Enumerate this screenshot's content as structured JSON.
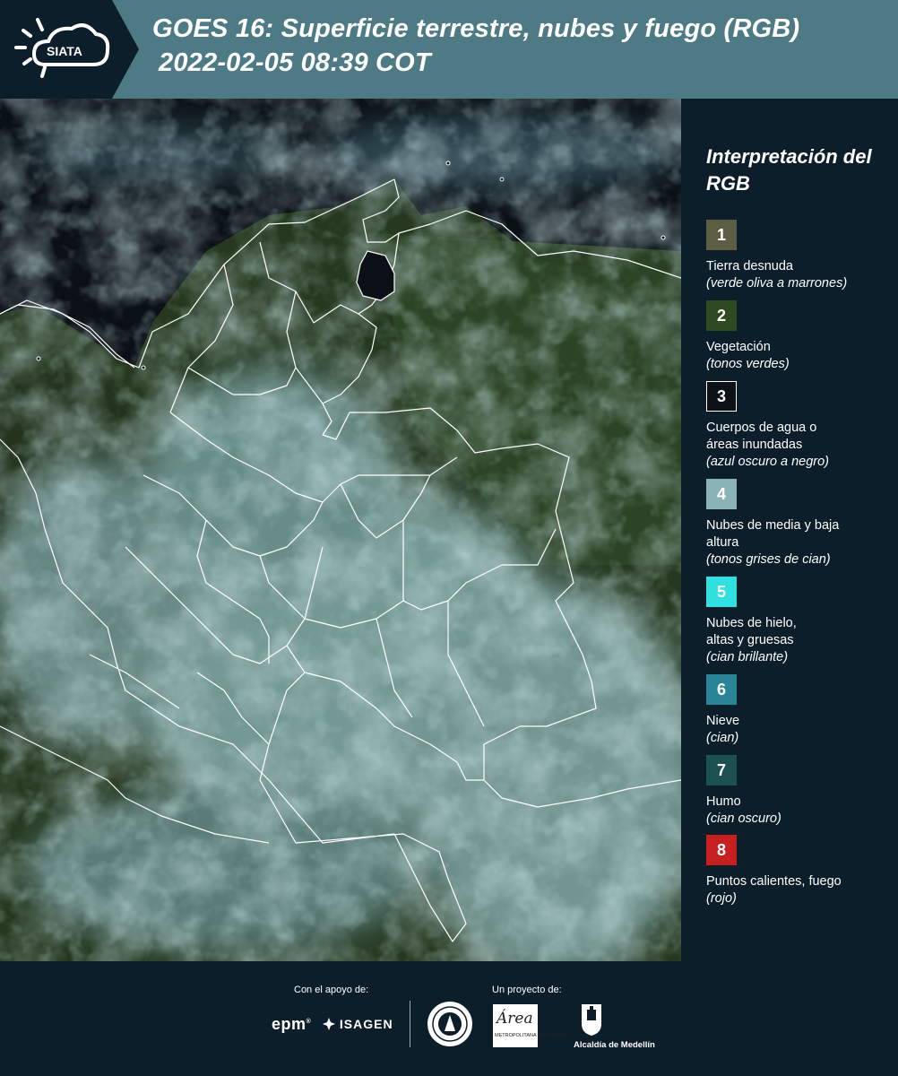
{
  "header": {
    "logo_text": "SIATA",
    "title_line1": "GOES 16: Superficie terrestre, nubes y fuego (RGB)",
    "title_line2": "2022-02-05 08:39 COT"
  },
  "legend": {
    "title": "Interpretación del RGB",
    "items": [
      {
        "num": "1",
        "label": "Tierra desnuda",
        "sub": "(verde oliva a marrones)",
        "color": "#5c5d43"
      },
      {
        "num": "2",
        "label": "Vegetación",
        "sub": "(tonos verdes)",
        "color": "#2f4a22"
      },
      {
        "num": "3",
        "label": "Cuerpos de agua o áreas inundadas",
        "sub": "(azul oscuro a negro)",
        "color": "#0b1117"
      },
      {
        "num": "4",
        "label": "Nubes de media y baja altura",
        "sub": "(tonos grises de cian)",
        "color": "#8ab3b5"
      },
      {
        "num": "5",
        "label": "Nubes de hielo, altas y gruesas",
        "sub": "(cian brillante)",
        "color": "#2fe0e0"
      },
      {
        "num": "6",
        "label": "Nieve",
        "sub": "(cian)",
        "color": "#2a8497"
      },
      {
        "num": "7",
        "label": "Humo",
        "sub": "(cian oscuro)",
        "color": "#1d5050"
      },
      {
        "num": "8",
        "label": "Puntos calientes, fuego",
        "sub": "(rojo)",
        "color": "#c62020"
      }
    ]
  },
  "footer": {
    "support_label": "Con el apoyo de:",
    "project_label": "Un proyecto de:",
    "epm": "epm",
    "isagen": "ISAGEN",
    "area_script": "Área",
    "area_small": "METROPOLITANA Valle de Aburrá",
    "alcaldia": "Alcaldía de Medellín"
  }
}
